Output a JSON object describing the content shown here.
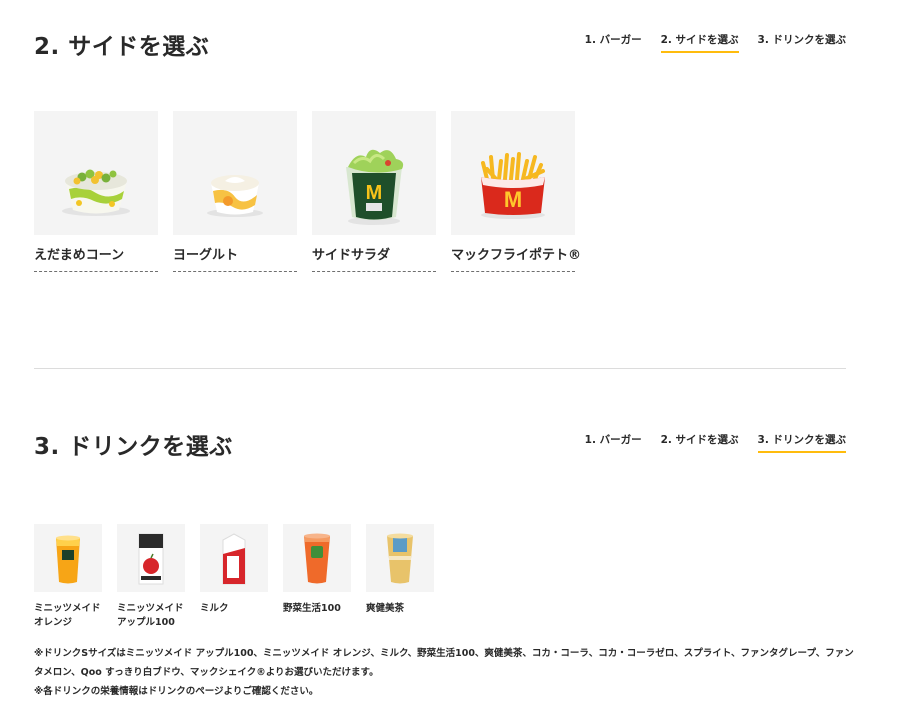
{
  "side_section": {
    "title": "2. サイドを選ぶ",
    "steps": [
      "1. バーガー",
      "2. サイドを選ぶ",
      "3. ドリンクを選ぶ"
    ],
    "active_step": 1,
    "items": [
      {
        "name": "えだまめコーン",
        "icon": "edamame-corn-cup"
      },
      {
        "name": "ヨーグルト",
        "icon": "yogurt-cup"
      },
      {
        "name": "サイドサラダ",
        "icon": "side-salad"
      },
      {
        "name": "マックフライポテト®",
        "icon": "french-fries"
      }
    ]
  },
  "drink_section": {
    "title": "3. ドリンクを選ぶ",
    "steps": [
      "1. バーガー",
      "2. サイドを選ぶ",
      "3. ドリンクを選ぶ"
    ],
    "active_step": 2,
    "items": [
      {
        "name": "ミニッツメイド\nオレンジ",
        "icon": "orange-juice-cup"
      },
      {
        "name": "ミニッツメイド\nアップル100",
        "icon": "apple-juice-carton"
      },
      {
        "name": "ミルク",
        "icon": "milk-carton"
      },
      {
        "name": "野菜生活100",
        "icon": "vegetable-juice-cup"
      },
      {
        "name": "爽健美茶",
        "icon": "tea-cup"
      }
    ],
    "notes": [
      "※ドリンクSサイズはミニッツメイド アップル100、ミニッツメイド オレンジ、ミルク、野菜生活100、爽健美茶、コカ・コーラ、コカ・コーラゼロ、スプライト、ファンタグレープ、ファンタメロン、Qoo すっきり白ブドウ、マックシェイク®よりお選びいただけます。",
      "※各ドリンクの栄養情報はドリンクのページよりご確認ください。"
    ]
  },
  "colors": {
    "accent": "#FFBC0D",
    "text": "#292929",
    "image_bg": "#f4f4f4",
    "mcd_red": "#DA291C"
  }
}
